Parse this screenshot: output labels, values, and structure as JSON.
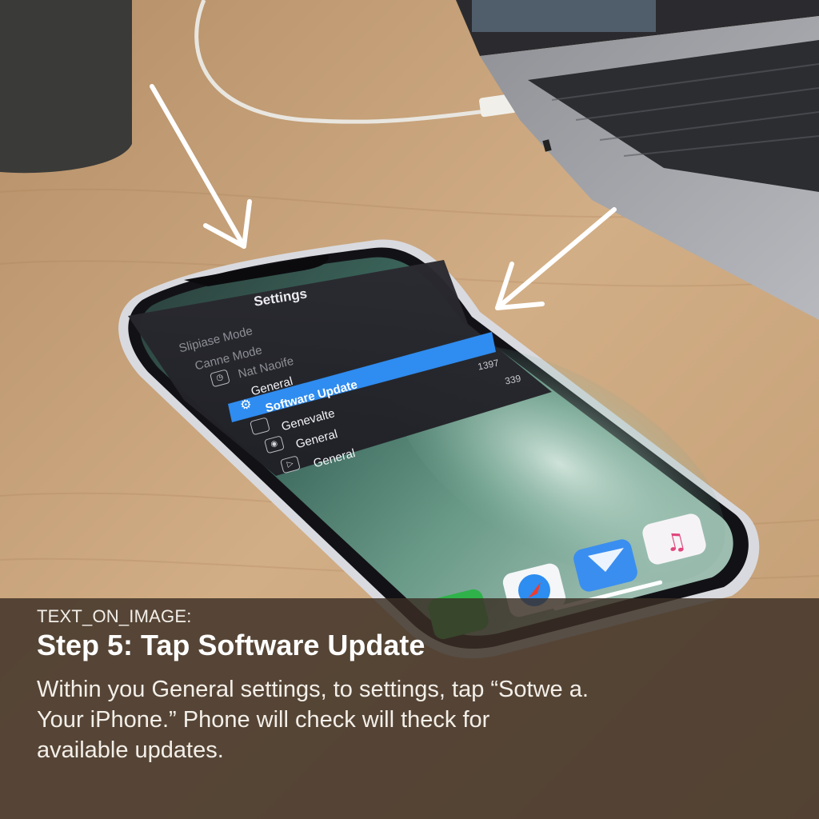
{
  "caption": {
    "tag": "TEXT_ON_IMAGE:",
    "title": "Step 5: Tap Software Update",
    "body_lines": [
      "Within you General settings, to settings, tap “Sotwe a.",
      "Your iPhone.” Phone will check will theck for",
      "available updates."
    ]
  },
  "phone_screen": {
    "title": "Settings",
    "faded_items": [
      "Slipiase Mode",
      "Canne Mode",
      "Nat Naoife"
    ],
    "items": [
      {
        "label": "General",
        "icon": "clock-icon"
      },
      {
        "label": "Software Update",
        "icon": "gear-icon",
        "selected": true,
        "badge": "1397"
      },
      {
        "label": "Genevalte",
        "icon": "display-icon",
        "badge": "339"
      },
      {
        "label": "General",
        "icon": "toggle-icon"
      },
      {
        "label": "General",
        "icon": "play-icon"
      }
    ]
  },
  "colors": {
    "highlight": "#2f8cf0",
    "caption_band": "#3a2e24",
    "desk": "#c9a57c"
  },
  "dock_icons": [
    "phone-app-icon",
    "safari-app-icon",
    "mail-app-icon",
    "music-app-icon"
  ]
}
